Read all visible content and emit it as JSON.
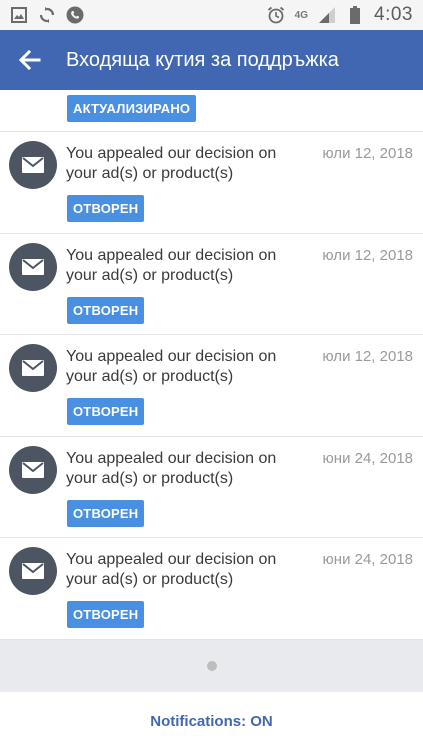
{
  "status_bar": {
    "left_icons": [
      "image-icon",
      "sync-icon",
      "phone-icon"
    ],
    "right_icons": [
      "alarm-icon",
      "signal-icon",
      "battery-icon"
    ],
    "network": "4G",
    "time": "4:03"
  },
  "app_bar": {
    "title": "Входяща кутия за поддръжка",
    "color": "#4267b2"
  },
  "top_partial": {
    "badge": "АКТУАЛИЗИРАНО"
  },
  "messages": [
    {
      "text": "You appealed our decision on your ad(s) or product(s)",
      "date": "юли 12, 2018",
      "status": "ОТВОРЕН"
    },
    {
      "text": "You appealed our decision on your ad(s) or product(s)",
      "date": "юли 12, 2018",
      "status": "ОТВОРЕН"
    },
    {
      "text": "You appealed our decision on your ad(s) or product(s)",
      "date": "юли 12, 2018",
      "status": "ОТВОРЕН"
    },
    {
      "text": "You appealed our decision on your ad(s) or product(s)",
      "date": "юни 24, 2018",
      "status": "ОТВОРЕН"
    },
    {
      "text": "You appealed our decision on your ad(s) or product(s)",
      "date": "юни 24, 2018",
      "status": "ОТВОРЕН"
    }
  ],
  "footer": {
    "notifications_label": "Notifications: ON"
  },
  "colors": {
    "accent": "#4267b2",
    "badge": "#4a90e2",
    "avatar": "#4d5462"
  }
}
